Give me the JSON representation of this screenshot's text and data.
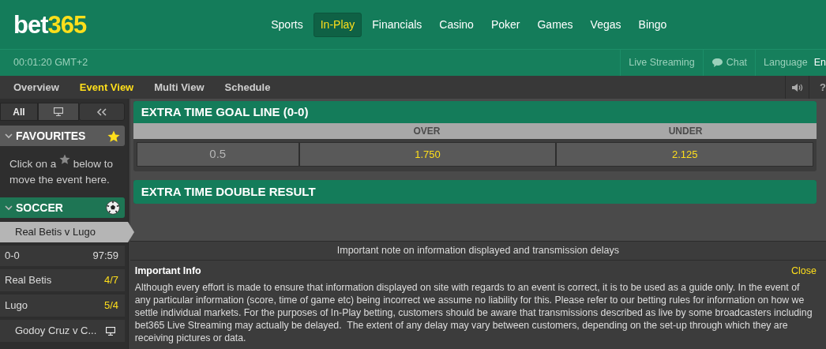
{
  "header": {
    "logo_main": "bet",
    "logo_accent": "365",
    "nav": [
      {
        "label": "Sports",
        "selected": false
      },
      {
        "label": "In-Play",
        "selected": true
      },
      {
        "label": "Financials",
        "selected": false
      },
      {
        "label": "Casino",
        "selected": false
      },
      {
        "label": "Poker",
        "selected": false
      },
      {
        "label": "Games",
        "selected": false
      },
      {
        "label": "Vegas",
        "selected": false
      },
      {
        "label": "Bingo",
        "selected": false
      }
    ]
  },
  "subbar": {
    "clock": "00:01:20 GMT+2",
    "live_streaming": "Live Streaming",
    "chat": "Chat",
    "language_label": "Language",
    "language_value": "En"
  },
  "view_tabs": [
    {
      "label": "Overview",
      "selected": false
    },
    {
      "label": "Event View",
      "selected": true
    },
    {
      "label": "Multi View",
      "selected": false
    },
    {
      "label": "Schedule",
      "selected": false
    }
  ],
  "help": "?",
  "sidebar": {
    "filter_tabs": [
      {
        "kind": "text",
        "label": "All",
        "selected": true
      },
      {
        "kind": "monitor",
        "selected": false
      }
    ],
    "favourites": {
      "title": "FAVOURITES",
      "expanded": true,
      "hint_before": "Click on a",
      "hint_after": "below to",
      "hint_line2": "move the event here."
    },
    "soccer": {
      "title": "SOCCER",
      "expanded": true,
      "events": [
        {
          "name": "Real Betis v Lugo",
          "selected": true,
          "score": "0-0",
          "clock": "97:59",
          "participants": [
            {
              "name": "Real Betis",
              "odds": "4/7"
            },
            {
              "name": "Lugo",
              "odds": "5/4"
            }
          ]
        },
        {
          "name": "Godoy Cruz v C...",
          "selected": false,
          "live_stream": true
        }
      ]
    }
  },
  "markets": [
    {
      "title": "EXTRA TIME GOAL LINE (0-0)",
      "columns": [
        "OVER",
        "UNDER"
      ],
      "rows": [
        {
          "line": "0.5",
          "odds": [
            "1.750",
            "2.125"
          ]
        }
      ]
    },
    {
      "title": "EXTRA TIME DOUBLE RESULT"
    }
  ],
  "note": {
    "banner": "Important note on information displayed and transmission delays",
    "title": "Important Info",
    "close": "Close",
    "body": "Although every effort is made to ensure that information displayed on site with regards to an event is correct, it is to be used as a guide only. In the event of any particular information (score, time of game etc) being incorrect we assume no liability for this. Please refer to our betting rules for information on how we settle individual markets. For the purposes of In-Play betting, customers should be aware that transmissions described as live by some broadcasters including bet365 Live Streaming may actually be delayed.  The extent of any delay may vary between customers, depending on the set-up through which they are receiving pictures or data."
  }
}
